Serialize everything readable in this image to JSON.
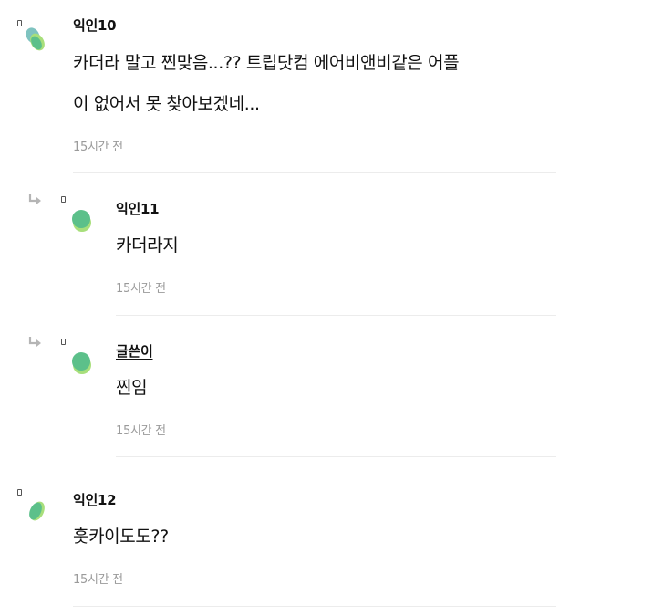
{
  "comments": [
    {
      "author": "익인10",
      "lines": [
        "카더라 말고 찐맞음...?? 트립닷컴 에어비앤비같은 어플",
        "이 없어서 못 찾아보겠네..."
      ],
      "time": "15시간 전"
    },
    {
      "author": "익인11",
      "lines": [
        "카더라지"
      ],
      "time": "15시간 전"
    },
    {
      "author": "글쓴이",
      "lines": [
        "찐임"
      ],
      "time": "15시간 전"
    },
    {
      "author": "익인12",
      "lines": [
        "훗카이도도??"
      ],
      "time": "15시간 전"
    }
  ],
  "icons": {
    "avatar": "green-blob-avatar",
    "reply": "reply-arrow-icon",
    "marker": "small-box-marker"
  },
  "colors": {
    "avatar_dark": "#5cc08a",
    "avatar_light": "#a8df7b",
    "avatar_teal": "#7fc3c0",
    "time_text": "#9a9a9a",
    "divider": "#ececec"
  }
}
